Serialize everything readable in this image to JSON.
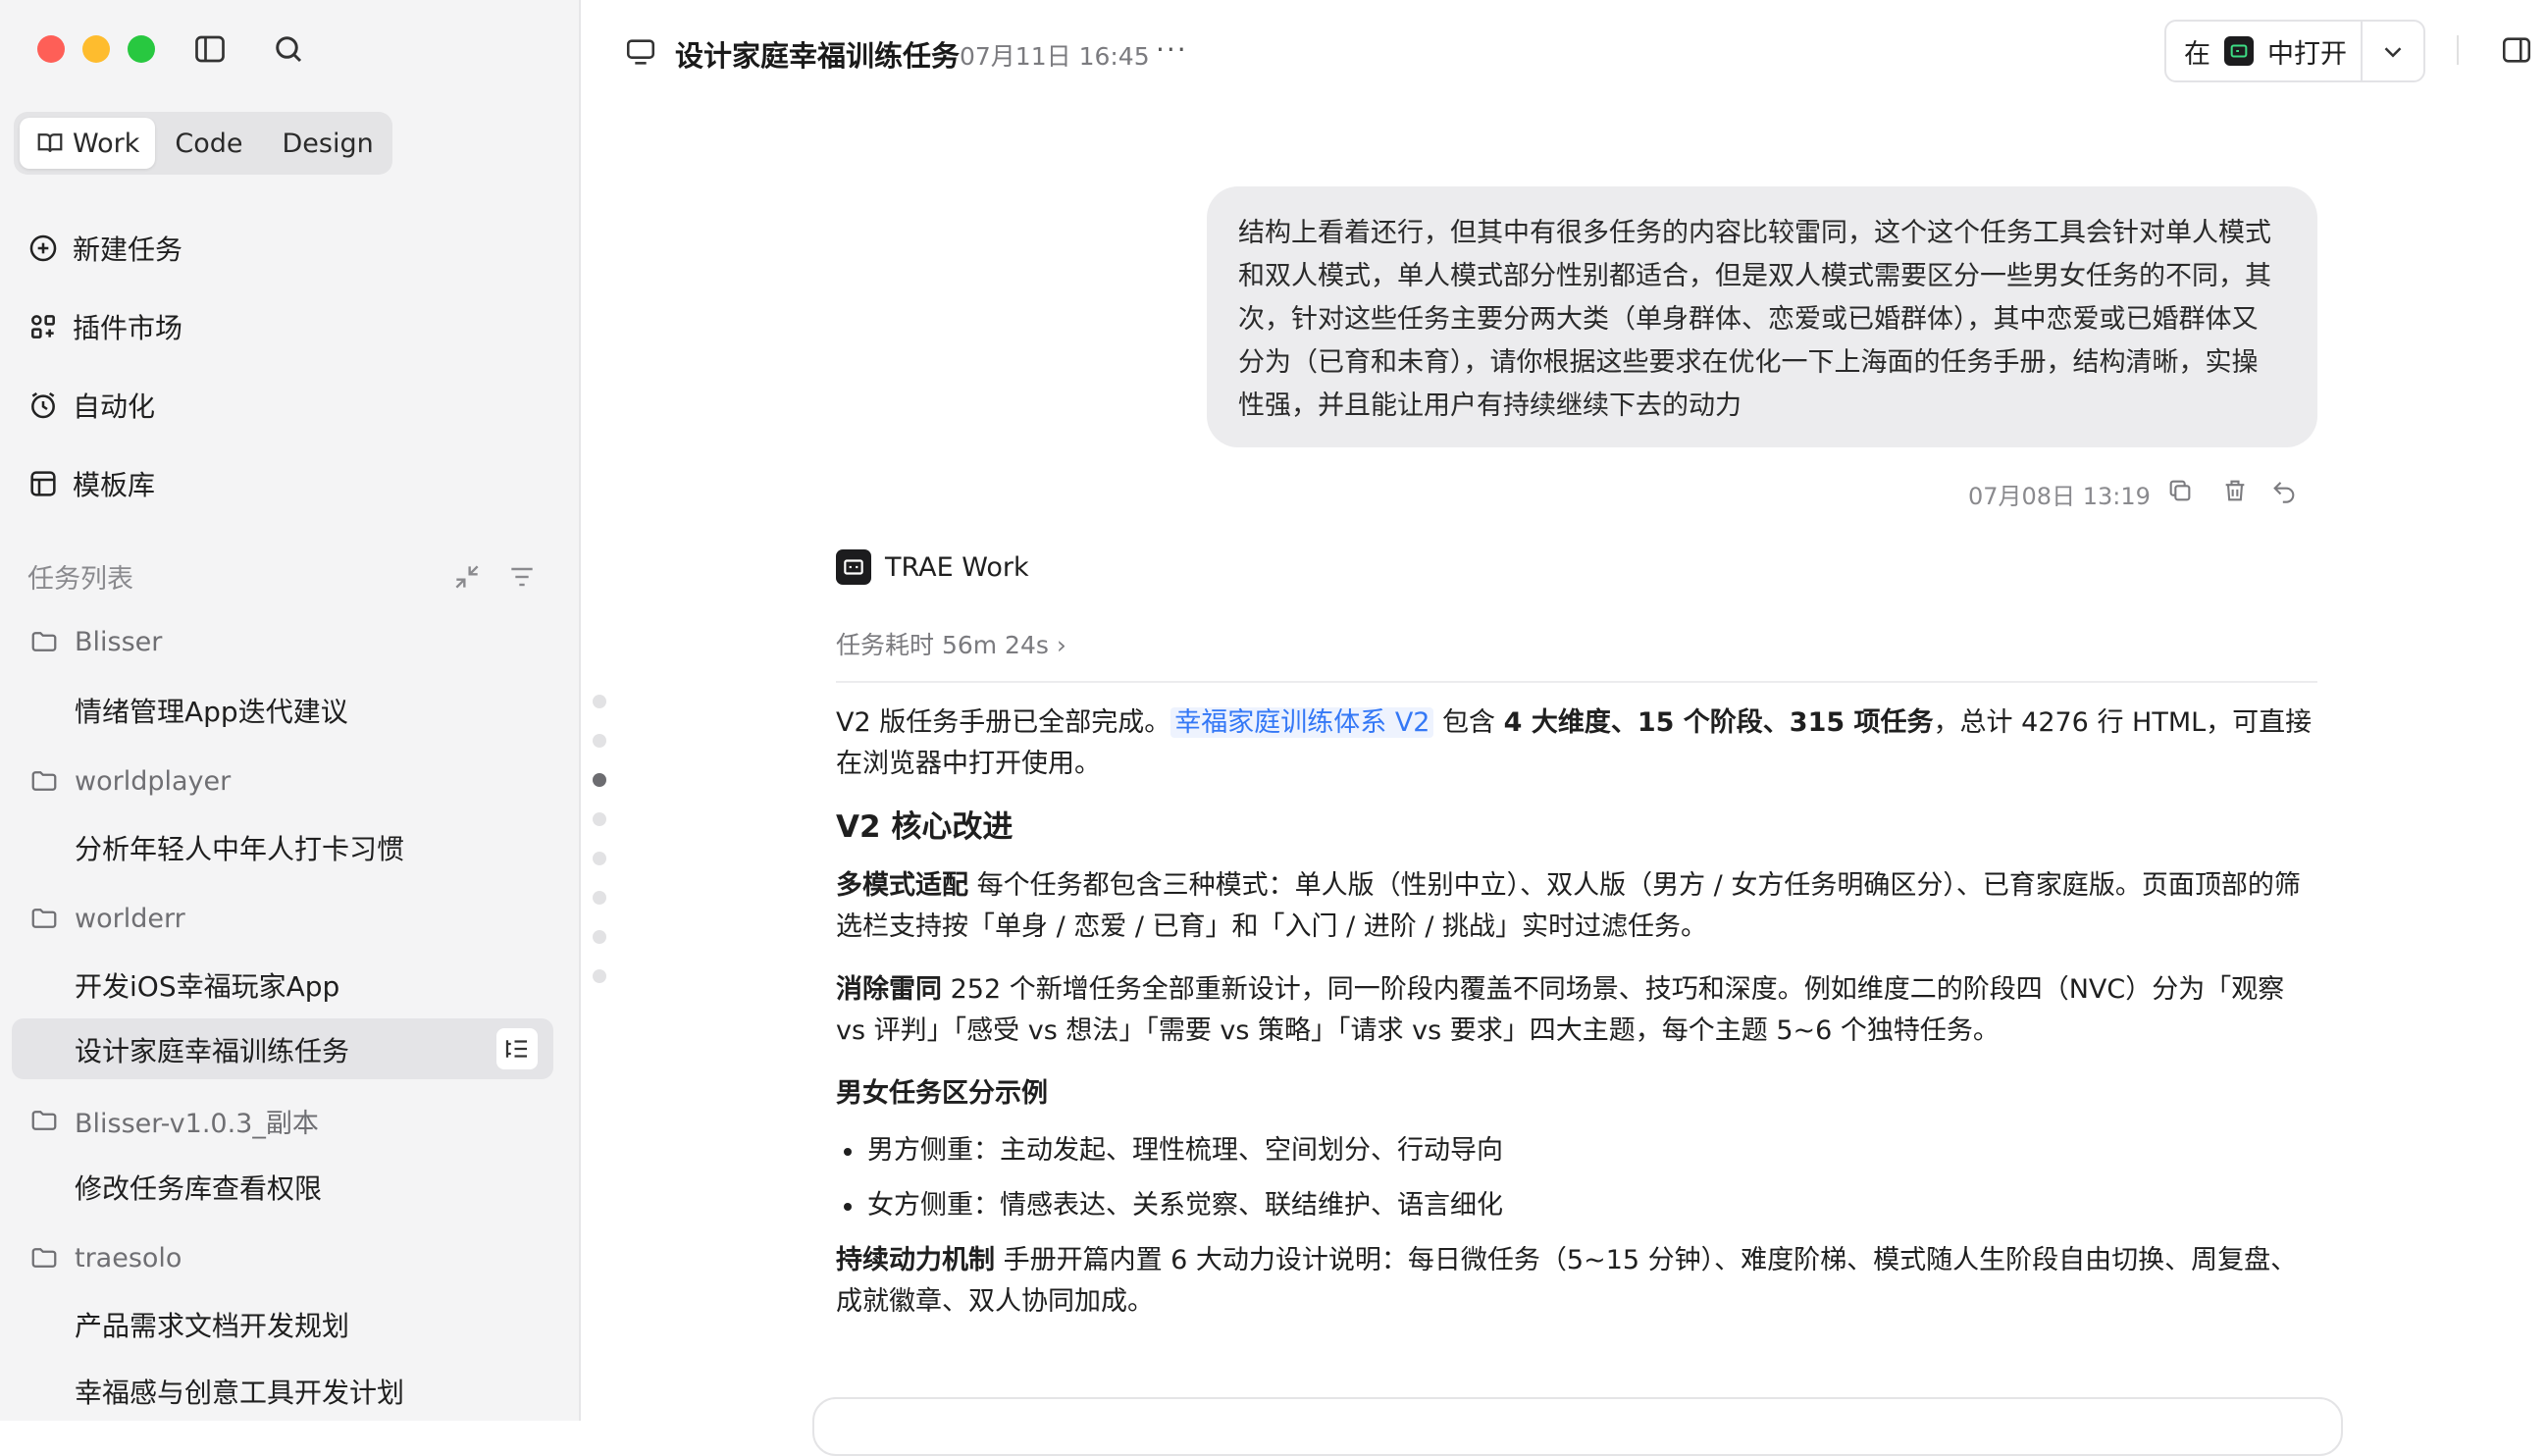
{
  "sidebar": {
    "segments": [
      "Work",
      "Code",
      "Design"
    ],
    "nav": [
      {
        "label": "新建任务",
        "icon": "plus-circle-icon"
      },
      {
        "label": "插件市场",
        "icon": "plugins-icon"
      },
      {
        "label": "自动化",
        "icon": "alarm-icon"
      },
      {
        "label": "模板库",
        "icon": "template-icon"
      }
    ],
    "section_label": "任务列表",
    "tree": [
      {
        "folder": "Blisser",
        "tasks": [
          "情绪管理App迭代建议"
        ]
      },
      {
        "folder": "worldplayer",
        "tasks": [
          "分析年轻人中年人打卡习惯"
        ]
      },
      {
        "folder": "worlderr",
        "tasks": [
          "开发iOS幸福玩家App",
          "设计家庭幸福训练任务"
        ]
      },
      {
        "folder": "Blisser-v1.0.3_副本",
        "tasks": [
          "修改任务库查看权限"
        ]
      },
      {
        "folder": "traesolo",
        "tasks": [
          "产品需求文档开发规划",
          "幸福感与创意工具开发计划"
        ]
      }
    ]
  },
  "header": {
    "title": "设计家庭幸福训练任务",
    "time": "07月11日 16:45",
    "more": "···",
    "open_prefix": "在",
    "open_suffix": "中打开"
  },
  "user_message": {
    "text": "结构上看着还行，但其中有很多任务的内容比较雷同，这个这个任务工具会针对单人模式和双人模式，单人模式部分性别都适合，但是双人模式需要区分一些男女任务的不同，其次，针对这些任务主要分两大类（单身群体、恋爱或已婚群体），其中恋爱或已婚群体又分为（已育和未育），请你根据这些要求在优化一下上海面的任务手册，结构清晰，实操性强，并且能让用户有持续继续下去的动力",
    "time": "07月08日 13:19"
  },
  "agent": {
    "name": "TRAE Work",
    "duration": "任务耗时 56m 24s ›",
    "intro_a": "V2 版任务手册已全部完成。",
    "intro_link": "幸福家庭训练体系 V2",
    "intro_b": " 包含 ",
    "intro_bold": "4 大维度、15 个阶段、315 项任务",
    "intro_c": "，总计 4276 行 HTML，可直接在浏览器中打开使用。",
    "h2": "V2 核心改进",
    "p1_bold": "多模式适配",
    "p1_text": " 每个任务都包含三种模式：单人版（性别中立）、双人版（男方 / 女方任务明确区分）、已育家庭版。页面顶部的筛选栏支持按「单身 / 恋爱 / 已育」和「入门 / 进阶 / 挑战」实时过滤任务。",
    "p2_bold": "消除雷同",
    "p2_text": " 252 个新增任务全部重新设计，同一阶段内覆盖不同场景、技巧和深度。例如维度二的阶段四（NVC）分为「观察 vs 评判」「感受 vs 想法」「需要 vs 策略」「请求 vs 要求」四大主题，每个主题 5~6 个独特任务。",
    "h3": "男女任务区分示例",
    "bullets": [
      "男方侧重：主动发起、理性梳理、空间划分、行动导向",
      "女方侧重：情感表达、关系觉察、联结维护、语言细化"
    ],
    "p3_bold": "持续动力机制",
    "p3_text": " 手册开篇内置 6 大动力设计说明：每日微任务（5~15 分钟）、难度阶梯、模式随人生阶段自由切换、周复盘、成就徽章、双人协同加成。"
  }
}
